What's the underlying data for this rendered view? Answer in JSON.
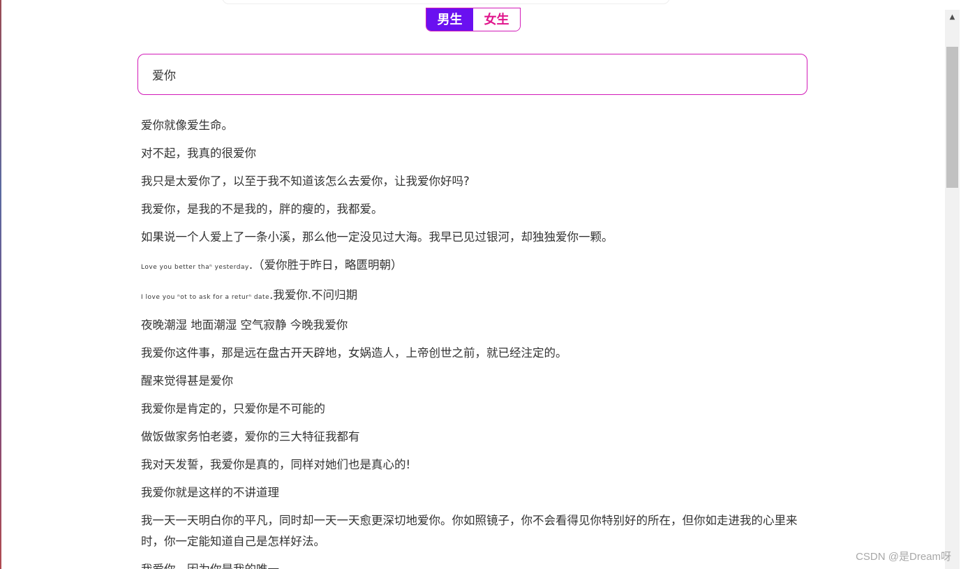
{
  "gender_toggle": {
    "male_label": "男生",
    "female_label": "女生",
    "selected": "male"
  },
  "search": {
    "value": "爱你"
  },
  "results": [
    {
      "text": "爱你就像爱生命。"
    },
    {
      "text": "对不起，我真的很爱你"
    },
    {
      "text": "我只是太爱你了，以至于我不知道该怎么去爱你，让我爱你好吗?"
    },
    {
      "text": "我爱你，是我的不是我的，胖的瘦的，我都爱。"
    },
    {
      "text": "如果说一个人爱上了一条小溪，那么他一定没见过大海。我早已见过银河，却独独爱你一颗。"
    },
    {
      "tiny": "Love you better thaⁿ yesterday",
      "text": ".（爱你胜于昨日，略匮明朝）"
    },
    {
      "tiny": "I love you ⁿot to ask for a returⁿ date",
      "text": ".我爱你.不问归期"
    },
    {
      "text": "夜晚潮湿 地面潮湿 空气寂静 今晚我爱你"
    },
    {
      "text": "我爱你这件事，那是远在盘古开天辟地，女娲造人，上帝创世之前，就已经注定的。"
    },
    {
      "text": "醒来觉得甚是爱你"
    },
    {
      "text": "我爱你是肯定的，只爱你是不可能的"
    },
    {
      "text": "做饭做家务怕老婆，爱你的三大特征我都有"
    },
    {
      "text": "我对天发誓，我爱你是真的，同样对她们也是真心的!"
    },
    {
      "text": "我爱你就是这样的不讲道理"
    },
    {
      "text": "我一天一天明白你的平凡，同时却一天一天愈更深切地爱你。你如照镜子，你不会看得见你特别好的所在，但你如走进我的心里来时，你一定能知道自己是怎样好法。"
    },
    {
      "text": "我爱你，因为你是我的唯一。"
    }
  ],
  "watermark": "CSDN @是Dream呀",
  "colors": {
    "accent_purple": "#6a10f0",
    "accent_magenta": "#d21ab8",
    "female_text": "#e0168c"
  }
}
